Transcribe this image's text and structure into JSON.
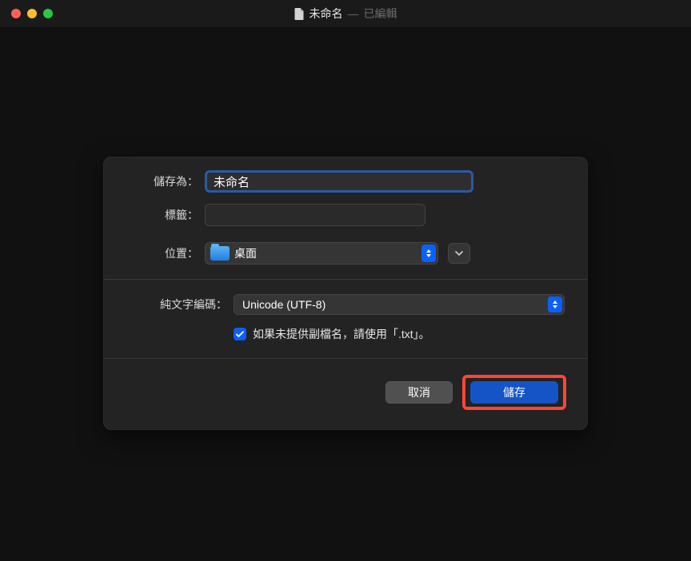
{
  "window": {
    "title": "未命名",
    "separator": "—",
    "status": "已編輯"
  },
  "dialog": {
    "saveAsLabel": "儲存為：",
    "saveAsValue": "未命名",
    "tagsLabel": "標籤：",
    "tagsValue": "",
    "whereLabel": "位置：",
    "whereValue": "桌面",
    "encodingLabel": "純文字編碼：",
    "encodingValue": "Unicode (UTF-8)",
    "checkboxLabel": "如果未提供副檔名，請使用「.txt」。",
    "checkboxChecked": true,
    "cancelLabel": "取消",
    "saveLabel": "儲存"
  },
  "colors": {
    "accent": "#0a60ff",
    "highlight": "#ff4636"
  }
}
